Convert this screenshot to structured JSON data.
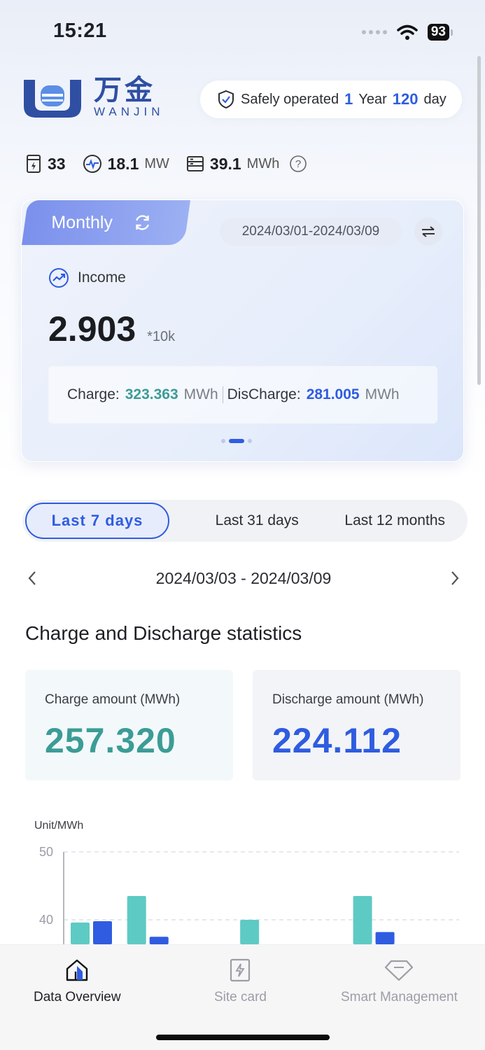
{
  "status_bar": {
    "time": "15:21",
    "battery": "93"
  },
  "brand": {
    "name_zh": "万金",
    "name_en": "WANJIN",
    "color": "#2f4fa3"
  },
  "safety": {
    "prefix": "Safely operated",
    "years": "1",
    "years_unit": "Year",
    "days": "120",
    "days_unit": "day"
  },
  "metrics": [
    {
      "icon": "cabinet-icon",
      "value": "33",
      "unit": ""
    },
    {
      "icon": "power-pulse-icon",
      "value": "18.1",
      "unit": "MW"
    },
    {
      "icon": "storage-icon",
      "value": "39.1",
      "unit": "MWh"
    }
  ],
  "summary_card": {
    "tab_label": "Monthly",
    "date_range": "2024/03/01-2024/03/09",
    "income_label": "Income",
    "income_value": "2.903",
    "income_unit": "*10k",
    "charge_label": "Charge:",
    "charge_value": "323.363",
    "charge_unit": "MWh",
    "discharge_label": "DisCharge:",
    "discharge_value": "281.005",
    "discharge_unit": "MWh",
    "pager_active": 1,
    "pager_count": 3
  },
  "period_tabs": [
    {
      "label": "Last 7 days",
      "active": true
    },
    {
      "label": "Last 31 days",
      "active": false
    },
    {
      "label": "Last 12 months",
      "active": false
    }
  ],
  "range": {
    "text": "2024/03/03 - 2024/03/09"
  },
  "section_title": "Charge and Discharge statistics",
  "charge_stat": {
    "label": "Charge amount (MWh)",
    "value": "257.320",
    "color": "#3c9c96"
  },
  "discharge_stat": {
    "label": "Discharge amount (MWh)",
    "value": "224.112",
    "color": "#2f5ce0"
  },
  "chart_data": {
    "type": "bar",
    "ylabel": "Unit/MWh",
    "ytick_labels": [
      "50",
      "40"
    ],
    "y_visible_range": [
      35.6,
      52.4
    ],
    "categories": [
      "",
      "",
      "",
      "",
      "",
      "",
      ""
    ],
    "series": [
      {
        "color": "#5ecac4",
        "values": [
          39.6,
          43.5,
          null,
          40.0,
          null,
          43.5,
          null
        ]
      },
      {
        "color": "#2f5ce0",
        "values": [
          39.8,
          37.5,
          null,
          null,
          null,
          38.2,
          null
        ]
      }
    ],
    "grid": "dashed-horizontal"
  },
  "tabbar": [
    {
      "label": "Data Overview",
      "icon": "data-overview-icon",
      "active": true
    },
    {
      "label": "Site card",
      "icon": "site-card-icon",
      "active": false
    },
    {
      "label": "Smart Management",
      "icon": "smart-management-icon",
      "active": false
    }
  ]
}
